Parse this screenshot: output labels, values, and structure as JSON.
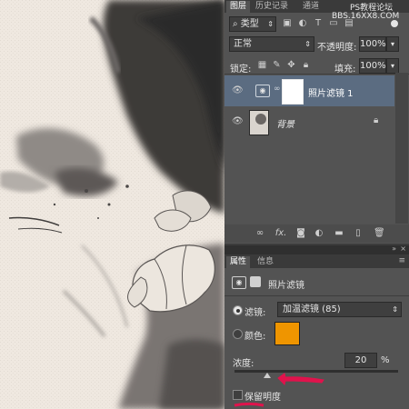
{
  "watermark": {
    "line1": "PS教程论坛",
    "line2": "BBS.16XX8.COM"
  },
  "layers_panel": {
    "tabs": [
      "图层",
      "历史记录",
      "通道"
    ],
    "filter_kind": "类型",
    "blend_mode": "正常",
    "opacity_label": "不透明度:",
    "opacity_value": "100%",
    "lock_label": "锁定:",
    "fill_label": "填充:",
    "fill_value": "100%",
    "layers": [
      {
        "name": "照片滤镜 1",
        "selected": true
      },
      {
        "name": "背景",
        "selected": false
      }
    ],
    "footer_icons": [
      "link-icon",
      "fx-icon",
      "mask-icon",
      "adjustment-icon",
      "folder-icon",
      "new-layer-icon",
      "trash-icon"
    ],
    "fx_text": "fx."
  },
  "properties_panel": {
    "tabs": [
      "属性",
      "信息"
    ],
    "title": "照片滤镜",
    "filter_label": "滤镜:",
    "filter_value": "加温滤镜 (85)",
    "color_label": "颜色:",
    "color_swatch": "#ef9500",
    "density_label": "浓度:",
    "density_value": "20",
    "density_unit": "%",
    "density_level": 0.2,
    "preserve_label": "保留明度",
    "annotation_color": "#e0134c"
  }
}
